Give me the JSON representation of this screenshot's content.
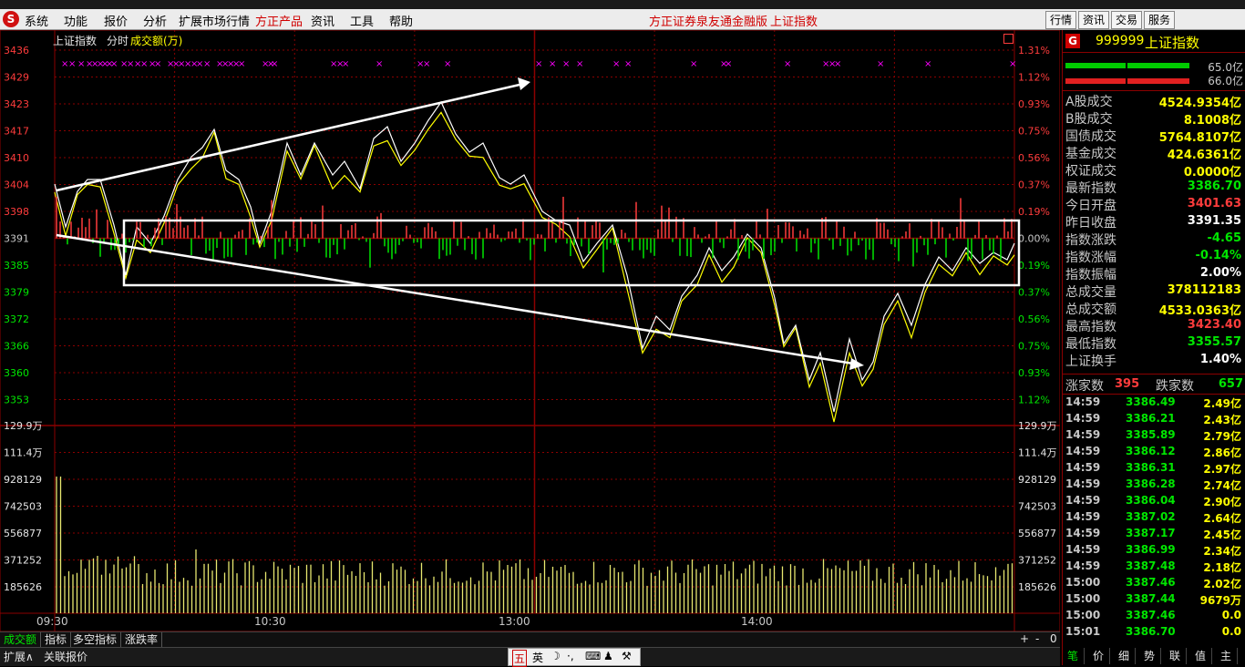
{
  "menu": {
    "items": [
      "系统",
      "功能",
      "报价",
      "分析",
      "扩展市场行情",
      "方正产品",
      "资讯",
      "工具",
      "帮助"
    ],
    "highlight": "方正产品",
    "center_title": "方正证券泉友通金融版",
    "center_index": "上证指数",
    "buttons": [
      "行情",
      "资讯",
      "交易",
      "服务"
    ]
  },
  "chart": {
    "header": {
      "name": "上证指数",
      "mode": "分时",
      "volume_label": "成交额(万)"
    },
    "price_ticks": [
      "3436",
      "3429",
      "3423",
      "3417",
      "3410",
      "3404",
      "3398",
      "3391",
      "3385",
      "3379",
      "3372",
      "3366",
      "3360",
      "3353"
    ],
    "pct_ticks": [
      "1.31%",
      "1.12%",
      "0.93%",
      "0.75%",
      "0.56%",
      "0.37%",
      "0.19%",
      "0.00%",
      "0.19%",
      "0.37%",
      "0.56%",
      "0.75%",
      "0.93%",
      "1.12%"
    ],
    "vol_ticks": [
      "129.9万",
      "111.4万",
      "928129",
      "742503",
      "556877",
      "371252",
      "185626"
    ],
    "time_ticks": [
      "09:30",
      "10:30",
      "13:00",
      "14:00"
    ],
    "box_controls": [
      "+",
      "-",
      "0"
    ]
  },
  "bottom_tabs": [
    "成交额",
    "指标",
    "多空指标",
    "涨跌率"
  ],
  "status_tabs": [
    "扩展∧",
    "关联报价"
  ],
  "ime": {
    "labels": [
      "五",
      "英"
    ]
  },
  "panel": {
    "code": "999999",
    "name": "上证指数",
    "logo": "G",
    "bar1_value": "65.0亿",
    "bar2_value": "66.0亿",
    "stats": [
      {
        "k": "A股成交",
        "v": "4524.9354亿",
        "c": "yellow"
      },
      {
        "k": "B股成交",
        "v": "8.1008亿",
        "c": "yellow"
      },
      {
        "k": "国债成交",
        "v": "5764.8107亿",
        "c": "yellow"
      },
      {
        "k": "基金成交",
        "v": "424.6361亿",
        "c": "yellow"
      },
      {
        "k": "权证成交",
        "v": "0.0000亿",
        "c": "yellow"
      },
      {
        "k": "最新指数",
        "v": "3386.70",
        "c": "green"
      },
      {
        "k": "今日开盘",
        "v": "3401.63",
        "c": "red"
      },
      {
        "k": "昨日收盘",
        "v": "3391.35",
        "c": "white"
      },
      {
        "k": "指数涨跌",
        "v": "-4.65",
        "c": "green"
      },
      {
        "k": "指数涨幅",
        "v": "-0.14%",
        "c": "green"
      },
      {
        "k": "指数振幅",
        "v": "2.00%",
        "c": "white"
      },
      {
        "k": "总成交量",
        "v": "378112183",
        "c": "yellow"
      },
      {
        "k": "总成交额",
        "v": "4533.0363亿",
        "c": "yellow"
      },
      {
        "k": "最高指数",
        "v": "3423.40",
        "c": "red"
      },
      {
        "k": "最低指数",
        "v": "3355.57",
        "c": "green"
      },
      {
        "k": "上证换手",
        "v": "1.40%",
        "c": "white"
      }
    ],
    "up_label": "涨家数",
    "up_count": "395",
    "down_label": "跌家数",
    "down_count": "657",
    "ticks": [
      {
        "t": "14:59",
        "p": "3386.49",
        "q": "2.49亿"
      },
      {
        "t": "14:59",
        "p": "3386.21",
        "q": "2.43亿"
      },
      {
        "t": "14:59",
        "p": "3385.89",
        "q": "2.79亿"
      },
      {
        "t": "14:59",
        "p": "3386.12",
        "q": "2.86亿"
      },
      {
        "t": "14:59",
        "p": "3386.31",
        "q": "2.97亿"
      },
      {
        "t": "14:59",
        "p": "3386.28",
        "q": "2.74亿"
      },
      {
        "t": "14:59",
        "p": "3386.04",
        "q": "2.90亿"
      },
      {
        "t": "14:59",
        "p": "3387.02",
        "q": "2.64亿"
      },
      {
        "t": "14:59",
        "p": "3387.17",
        "q": "2.45亿"
      },
      {
        "t": "14:59",
        "p": "3386.99",
        "q": "2.34亿"
      },
      {
        "t": "14:59",
        "p": "3387.48",
        "q": "2.18亿"
      },
      {
        "t": "15:00",
        "p": "3387.46",
        "q": "2.02亿"
      },
      {
        "t": "15:00",
        "p": "3387.44",
        "q": "9679万"
      },
      {
        "t": "15:00",
        "p": "3387.46",
        "q": "0.0"
      },
      {
        "t": "15:01",
        "p": "3386.70",
        "q": "0.0"
      }
    ],
    "bottom_tabs": [
      "笔",
      "价",
      "细",
      "势",
      "联",
      "值",
      "主"
    ]
  },
  "colors": {
    "up": "#ff3c3c",
    "down": "#00e600",
    "grid": "#8b0000",
    "price": "#ffffff",
    "avg": "#ffff00"
  }
}
